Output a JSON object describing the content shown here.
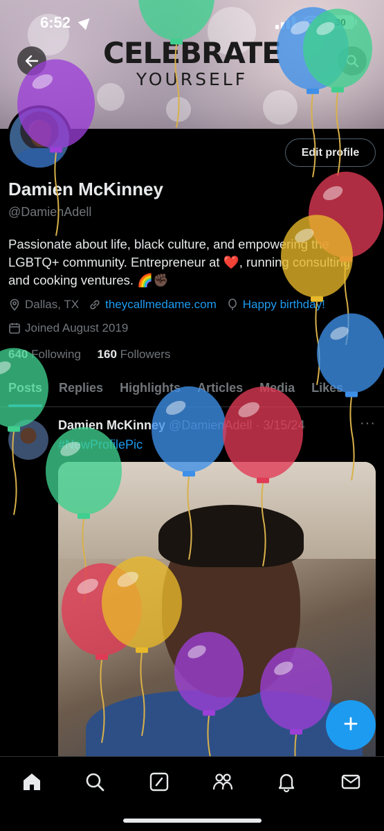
{
  "status_bar": {
    "time": "6:52",
    "battery": "30"
  },
  "banner": {
    "title": "CELEBRATE",
    "subtitle": "YOURSELF"
  },
  "profile": {
    "edit_label": "Edit profile",
    "name": "Damien McKinney",
    "handle": "@DamienAdell",
    "bio": "Passionate about life, black culture, and empowering the LGBTQ+ community. Entrepreneur at ❤️, running consulting and cooking ventures. 🌈✊🏿",
    "location": "Dallas, TX",
    "website": "theycallmedame.com",
    "birthday": "Happy birthday!",
    "joined": "Joined August 2019",
    "following_count": "640",
    "following_label": "Following",
    "followers_count": "160",
    "followers_label": "Followers"
  },
  "tabs": [
    {
      "label": "Posts",
      "active": true
    },
    {
      "label": "Replies"
    },
    {
      "label": "Highlights"
    },
    {
      "label": "Articles"
    },
    {
      "label": "Media"
    },
    {
      "label": "Likes"
    }
  ],
  "post": {
    "author": "Damien McKinney",
    "handle": "@DamienAdell",
    "date": "· 3/15/24",
    "more": "···",
    "text": "#NewProfilePic"
  },
  "fab": {
    "label": "+"
  },
  "colors": {
    "accent": "#1d9bf0",
    "balloon_purple": "#9b3fd6",
    "balloon_green": "#3fcf8e",
    "balloon_blue": "#3d8fe8",
    "balloon_red": "#e03a55",
    "balloon_yellow": "#e8b92a"
  },
  "nav_icons": [
    "home-icon",
    "search-icon",
    "compose-icon",
    "communities-icon",
    "notifications-icon",
    "messages-icon"
  ]
}
